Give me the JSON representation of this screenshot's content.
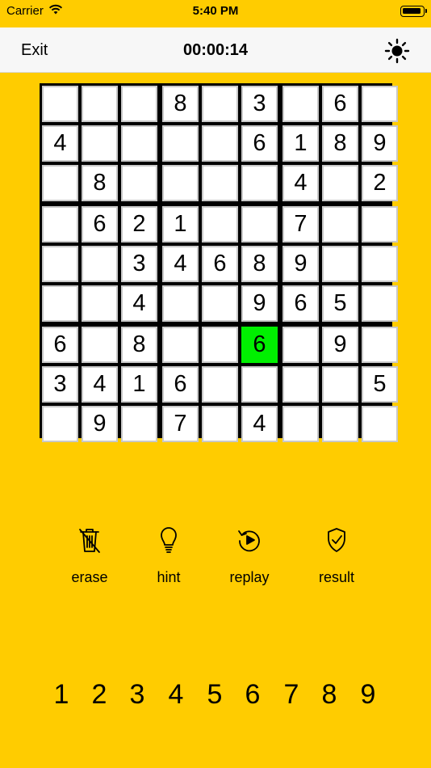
{
  "status_bar": {
    "carrier": "Carrier",
    "time": "5:40 PM"
  },
  "nav": {
    "exit_label": "Exit",
    "timer": "00:00:14",
    "theme_icon": "sun-icon"
  },
  "board": {
    "selected": {
      "row": 6,
      "col": 5
    },
    "selected_color": "#00F000",
    "grid": [
      [
        "",
        "",
        "",
        "8",
        "",
        "3",
        "",
        "6",
        ""
      ],
      [
        "4",
        "",
        "",
        "",
        "",
        "6",
        "1",
        "8",
        "9"
      ],
      [
        "",
        "8",
        "",
        "",
        "",
        "",
        "4",
        "",
        "2"
      ],
      [
        "",
        "6",
        "2",
        "1",
        "",
        "",
        "7",
        "",
        ""
      ],
      [
        "",
        "",
        "3",
        "4",
        "6",
        "8",
        "9",
        "",
        ""
      ],
      [
        "",
        "",
        "4",
        "",
        "",
        "9",
        "6",
        "5",
        ""
      ],
      [
        "6",
        "",
        "8",
        "",
        "",
        "6",
        "",
        "9",
        ""
      ],
      [
        "3",
        "4",
        "1",
        "6",
        "",
        "",
        "",
        "",
        "5"
      ],
      [
        "",
        "9",
        "",
        "7",
        "",
        "4",
        "",
        "",
        ""
      ]
    ]
  },
  "tools": [
    {
      "id": "erase",
      "label": "erase",
      "icon": "trash-icon"
    },
    {
      "id": "hint",
      "label": "hint",
      "icon": "lightbulb-icon"
    },
    {
      "id": "replay",
      "label": "replay",
      "icon": "replay-icon"
    },
    {
      "id": "result",
      "label": "result",
      "icon": "shield-check-icon"
    }
  ],
  "numpad": [
    "1",
    "2",
    "3",
    "4",
    "5",
    "6",
    "7",
    "8",
    "9"
  ],
  "colors": {
    "background": "#FFCC00",
    "nav_background": "#F7F7F7"
  }
}
